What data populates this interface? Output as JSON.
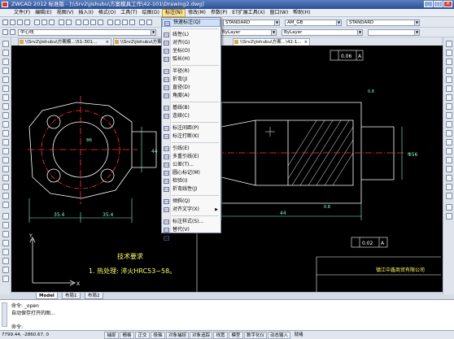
{
  "window": {
    "title": "ZWCAD 2012 标准版 - [\\\\Srv2\\jishubu\\方案模具工作\\42-101\\Drawing2.dwg]"
  },
  "menu": {
    "items": [
      "文件(F)",
      "编辑(E)",
      "视图(V)",
      "插入(I)",
      "格式(O)",
      "工具(T)",
      "绘图(D)",
      "标注(N)",
      "修改(M)",
      "参数(P)",
      "ET扩展工具(X)",
      "窗口(W)",
      "帮助(H)"
    ],
    "active_index": 7
  },
  "toolbar": {
    "layer_value": "中心线",
    "textstyle_value": "STANDARD",
    "dimstyle_value": "AM_GB",
    "tablestyle_value": "STANDARD",
    "color_value": "ByLayer",
    "linetype_value": "ByLayer"
  },
  "doc_tabs": [
    "\\\\Srv2\\jishubu\\方案模...\\51-301...",
    "\\\\Srv2\\jishubu\\方案模...",
    "\\\\Srv2\\jishubu\\方案...\\42-1..."
  ],
  "dim_menu": [
    {
      "label": "快速标注(Q)",
      "icon": "quick-dimension-icon",
      "highlight": true
    },
    {
      "sep": true
    },
    {
      "label": "线性(L)",
      "icon": "linear-dimension-icon"
    },
    {
      "label": "对齐(G)",
      "icon": "aligned-dimension-icon"
    },
    {
      "label": "坐标(O)",
      "icon": "ordinate-dimension-icon"
    },
    {
      "label": "弧长(H)",
      "icon": "arc-length-icon"
    },
    {
      "sep": true
    },
    {
      "label": "半径(R)",
      "icon": "radius-icon"
    },
    {
      "label": "折弯(J)",
      "icon": "jogged-icon"
    },
    {
      "label": "直径(D)",
      "icon": "diameter-icon"
    },
    {
      "label": "角度(A)",
      "icon": "angle-icon"
    },
    {
      "sep": true
    },
    {
      "label": "基线(B)",
      "icon": "baseline-icon"
    },
    {
      "label": "连续(C)",
      "icon": "continue-icon"
    },
    {
      "sep": true
    },
    {
      "label": "标注间距(P)",
      "icon": "dim-space-icon"
    },
    {
      "label": "标注打断(K)",
      "icon": "dim-break-icon"
    },
    {
      "sep": true
    },
    {
      "label": "引线(E)",
      "icon": "leader-icon"
    },
    {
      "label": "多重引线(E)",
      "icon": "multileader-icon"
    },
    {
      "label": "公差(T)...",
      "icon": "tolerance-icon"
    },
    {
      "label": "圆心标记(M)",
      "icon": "center-mark-icon"
    },
    {
      "label": "检验(I)",
      "icon": "inspect-icon"
    },
    {
      "label": "折弯线性(J)",
      "icon": "jogged-linear-icon"
    },
    {
      "sep": true
    },
    {
      "label": "倾斜(Q)",
      "icon": "oblique-icon"
    },
    {
      "label": "对齐文字(X)",
      "icon": "align-text-icon",
      "submenu": true
    },
    {
      "sep": true
    },
    {
      "label": "标注样式(S)...",
      "icon": "dim-style-icon"
    },
    {
      "label": "替代(V)",
      "icon": "override-icon"
    },
    {
      "label": "更新(U)",
      "icon": "update-icon"
    }
  ],
  "drawing": {
    "dims": [
      "35.4",
      "35.4",
      "44",
      "Φ6",
      "Φ56",
      "44",
      "0.8",
      "0.8"
    ],
    "tol_frame_1": "0.06",
    "tol_frame_1_ref": "A",
    "tol_frame_2": "0.02",
    "tol_frame_2_ref": "A",
    "tech_title": "技术要求",
    "tech_note": "1. 热处理: 淬火HRC53~58。",
    "company": "镇江中鑫商贸有限公司"
  },
  "layout_tabs": [
    "Model",
    "布局1",
    "布局2"
  ],
  "command": {
    "lines": [
      "命令: _open",
      "自动保存打开的图...",
      "命令:"
    ]
  },
  "status": {
    "coords": "7799.44, -2860.67, 0",
    "buttons": [
      "捕捉",
      "栅格",
      "正交",
      "极轴",
      "对象捕捉",
      "对象追踪",
      "线宽",
      "模型",
      "数字化仪",
      "动态输入",
      "就绪"
    ]
  },
  "colors": {
    "cad_bg": "#000000",
    "menu_highlight": "#cfe0f7",
    "accent": "#2c4f95"
  }
}
